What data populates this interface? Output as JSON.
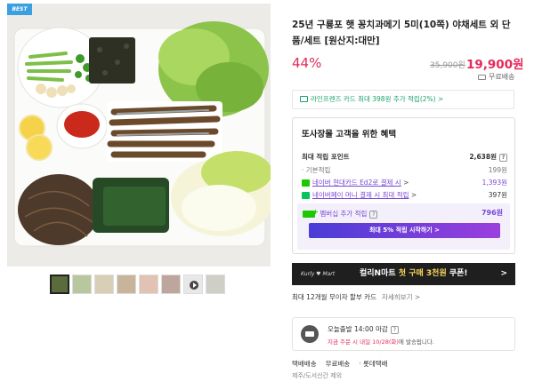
{
  "product": {
    "badge": "BEST",
    "title": "25년 구룡포 햇 꽁치과메기 5미(10쪽) 야채세트 외 단품/세트 [원산지:대만]",
    "discount": "44%",
    "original_price": "35,900원",
    "sale_price": "19,900원",
    "shipping_label": "무료배송"
  },
  "card_benefit": {
    "text": "라인프렌즈 카드 최대 398원 추가 적립(2%) >"
  },
  "benefits": {
    "title": "또사장몰 고객을 위한 혜택",
    "max_points_label": "최대 적립 포인트",
    "max_points_value": "2,638원",
    "basic_label": "· 기본적립",
    "basic_value": "199원",
    "hyundai_label": "네이버 현대카드 Ed2로 결제 시",
    "hyundai_value": "1,393원",
    "npay_label": "네이버페이 머니 결제 시 최대 적립",
    "npay_value": "397원",
    "membership_label": "멤버십 추가 적립",
    "membership_value": "796원",
    "membership_button": "최대 5% 적립 시작하기 >"
  },
  "kurly": {
    "logo": "Kurly ♥ Mart",
    "text_prefix": "컬리N마트 ",
    "text_accent": "첫 구매 3천원",
    "text_suffix": " 쿠폰!",
    "chevron": ">"
  },
  "installment": {
    "text": "최대 12개월 무이자 할부 카드",
    "more": "자세히보기 >"
  },
  "delivery": {
    "title": "오늘출발 14:00 마감",
    "sub_red": "지금 주문 시 내일 10/28(화)",
    "sub_gray": "에 발송됩니다."
  },
  "shipping": {
    "type": "택배배송",
    "fee": "무료배송",
    "carrier": "· 롯데택배",
    "note": "제주/도서산간 제외"
  },
  "colors": {
    "accent_red": "#e5295a",
    "naver_green": "#1ec800",
    "purple": "#7a46d6"
  }
}
